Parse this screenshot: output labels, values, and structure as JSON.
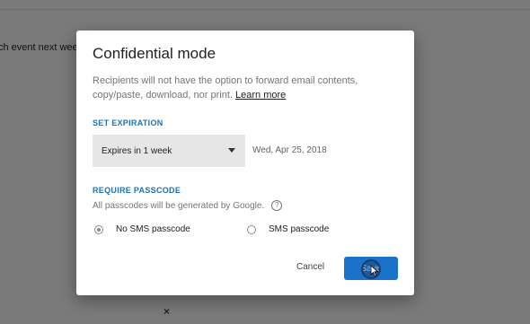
{
  "background": {
    "email_text": "ch event next week.",
    "close_glyph": "×"
  },
  "dialog": {
    "title": "Confidential mode",
    "description": "Recipients will not have the option to forward email contents, copy/paste, download, nor print.",
    "learn_more": "Learn more",
    "expiration": {
      "label": "SET EXPIRATION",
      "selected": "Expires in 1 week",
      "date": "Wed, Apr 25, 2018"
    },
    "passcode": {
      "label": "REQUIRE PASSCODE",
      "note": "All passcodes will be generated by Google.",
      "help_glyph": "?",
      "options": [
        {
          "label": "No SMS passcode",
          "selected": true
        },
        {
          "label": "SMS passcode",
          "selected": false
        }
      ]
    },
    "buttons": {
      "cancel": "Cancel",
      "save": "Save"
    }
  },
  "colors": {
    "accent": "#1a73c9",
    "section_label": "#1a73b8",
    "overlay": "#7a7a7a"
  }
}
